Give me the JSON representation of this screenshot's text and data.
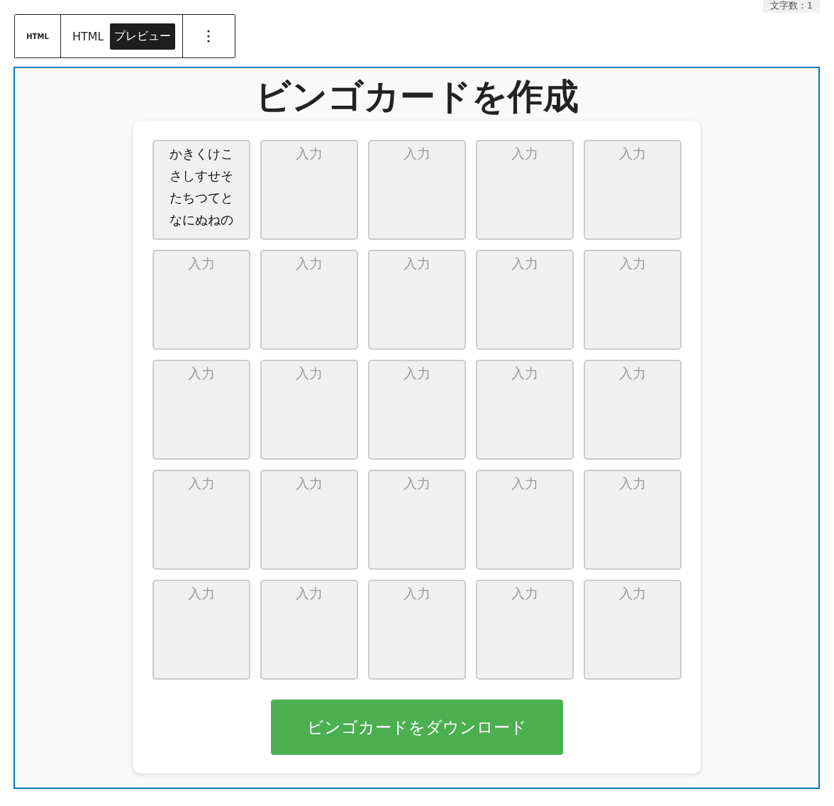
{
  "char_count": "文字数：1",
  "toolbar": {
    "block_label": "HTML",
    "tabs": [
      {
        "label": "HTML",
        "selected": false
      },
      {
        "label": "プレビュー",
        "selected": true
      }
    ]
  },
  "title": "ビンゴカードを作成",
  "cells": [
    {
      "value": "かきくけこさしすせそたちつてとなにぬねの"
    },
    {
      "placeholder": "入力"
    },
    {
      "placeholder": "入力"
    },
    {
      "placeholder": "入力"
    },
    {
      "placeholder": "入力"
    },
    {
      "placeholder": "入力"
    },
    {
      "placeholder": "入力"
    },
    {
      "placeholder": "入力"
    },
    {
      "placeholder": "入力"
    },
    {
      "placeholder": "入力"
    },
    {
      "placeholder": "入力"
    },
    {
      "placeholder": "入力"
    },
    {
      "placeholder": "入力"
    },
    {
      "placeholder": "入力"
    },
    {
      "placeholder": "入力"
    },
    {
      "placeholder": "入力"
    },
    {
      "placeholder": "入力"
    },
    {
      "placeholder": "入力"
    },
    {
      "placeholder": "入力"
    },
    {
      "placeholder": "入力"
    },
    {
      "placeholder": "入力"
    },
    {
      "placeholder": "入力"
    },
    {
      "placeholder": "入力"
    },
    {
      "placeholder": "入力"
    },
    {
      "placeholder": "入力"
    }
  ],
  "download_button": "ビンゴカードをダウンロード"
}
